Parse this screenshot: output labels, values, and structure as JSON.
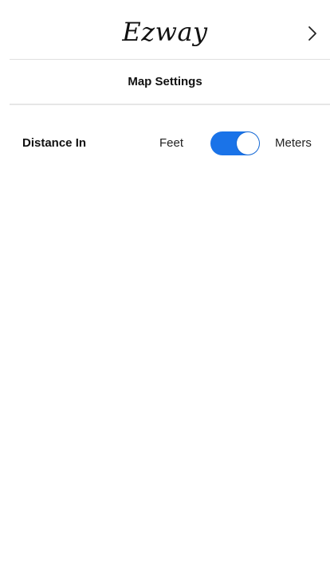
{
  "header": {
    "brand": "Ezway",
    "next_icon": "chevron-right-icon"
  },
  "page": {
    "title": "Map Settings"
  },
  "settings": {
    "distance": {
      "label": "Distance In",
      "option_left": "Feet",
      "option_right": "Meters",
      "selected": "Meters"
    }
  },
  "colors": {
    "toggle_on": "#1a73e8",
    "divider": "#e0e0e0",
    "background": "#ffffff"
  }
}
